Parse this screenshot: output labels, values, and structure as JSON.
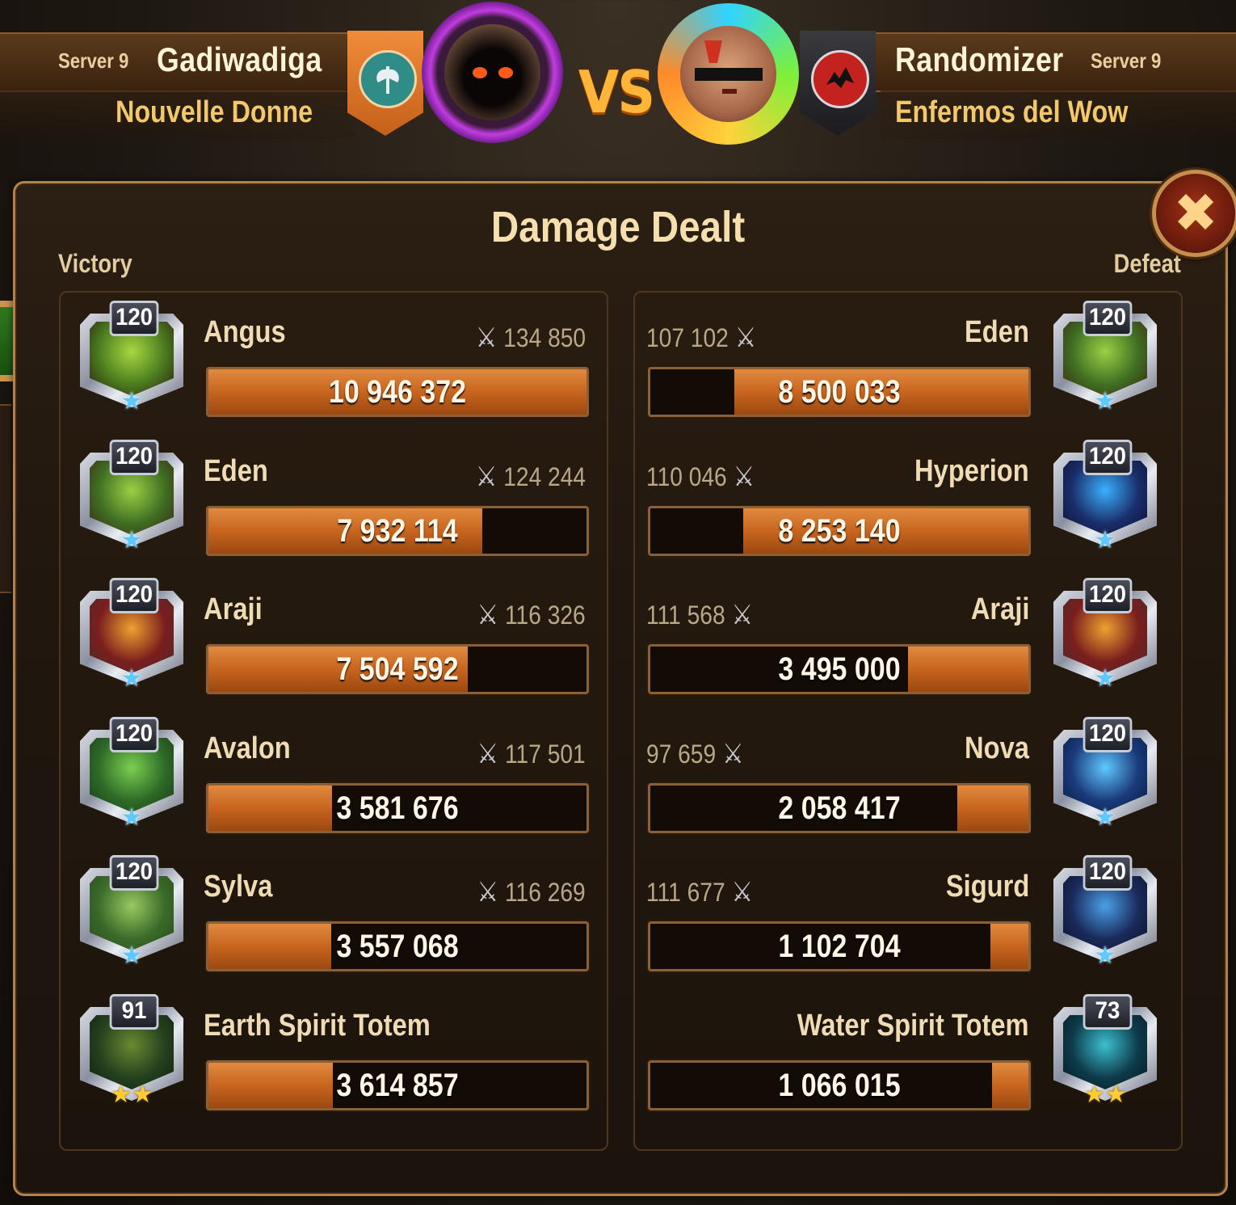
{
  "header": {
    "left": {
      "server": "Server 9",
      "player": "Gadiwadiga",
      "guild": "Nouvelle Donne",
      "banner_color": "#e07a2e",
      "emblem_icon": "axe-icon"
    },
    "vs": "VS",
    "right": {
      "server": "Server 9",
      "player": "Randomizer",
      "guild": "Enfermos del Wow",
      "banner_color": "#2b2b2e",
      "emblem_icon": "dragon-icon"
    }
  },
  "panel": {
    "title": "Damage Dealt",
    "left_result": "Victory",
    "right_result": "Defeat",
    "close_icon": "close-icon"
  },
  "colors": {
    "bar_fill": "#c8651f",
    "bar_empty": "#120b06",
    "accent_gold": "#f2c86a"
  },
  "left_team": [
    {
      "name": "Angus",
      "level": "120",
      "power": "134 850",
      "damage": "10 946 372",
      "damage_fraction": 1.0,
      "stars": 6
    },
    {
      "name": "Eden",
      "level": "120",
      "power": "124 244",
      "damage": "7 932 114",
      "damage_fraction": 0.725,
      "stars": 6
    },
    {
      "name": "Araji",
      "level": "120",
      "power": "116 326",
      "damage": "7 504 592",
      "damage_fraction": 0.686,
      "stars": 6
    },
    {
      "name": "Avalon",
      "level": "120",
      "power": "117 501",
      "damage": "3 581 676",
      "damage_fraction": 0.327,
      "stars": 6
    },
    {
      "name": "Sylva",
      "level": "120",
      "power": "116 269",
      "damage": "3 557 068",
      "damage_fraction": 0.325,
      "stars": 6
    },
    {
      "name": "Earth Spirit Totem",
      "level": "91",
      "power": "",
      "damage": "3 614 857",
      "damage_fraction": 0.33,
      "stars": 2
    }
  ],
  "right_team": [
    {
      "name": "Eden",
      "level": "120",
      "power": "107 102",
      "damage": "8 500 033",
      "damage_fraction": 0.777,
      "stars": 6
    },
    {
      "name": "Hyperion",
      "level": "120",
      "power": "110 046",
      "damage": "8 253 140",
      "damage_fraction": 0.754,
      "stars": 6
    },
    {
      "name": "Araji",
      "level": "120",
      "power": "111 568",
      "damage": "3 495 000",
      "damage_fraction": 0.319,
      "stars": 6
    },
    {
      "name": "Nova",
      "level": "120",
      "power": "97 659",
      "damage": "2 058 417",
      "damage_fraction": 0.188,
      "stars": 6
    },
    {
      "name": "Sigurd",
      "level": "120",
      "power": "111 677",
      "damage": "1 102 704",
      "damage_fraction": 0.101,
      "stars": 6
    },
    {
      "name": "Water Spirit Totem",
      "level": "73",
      "power": "",
      "damage": "1 066 015",
      "damage_fraction": 0.097,
      "stars": 2
    }
  ]
}
